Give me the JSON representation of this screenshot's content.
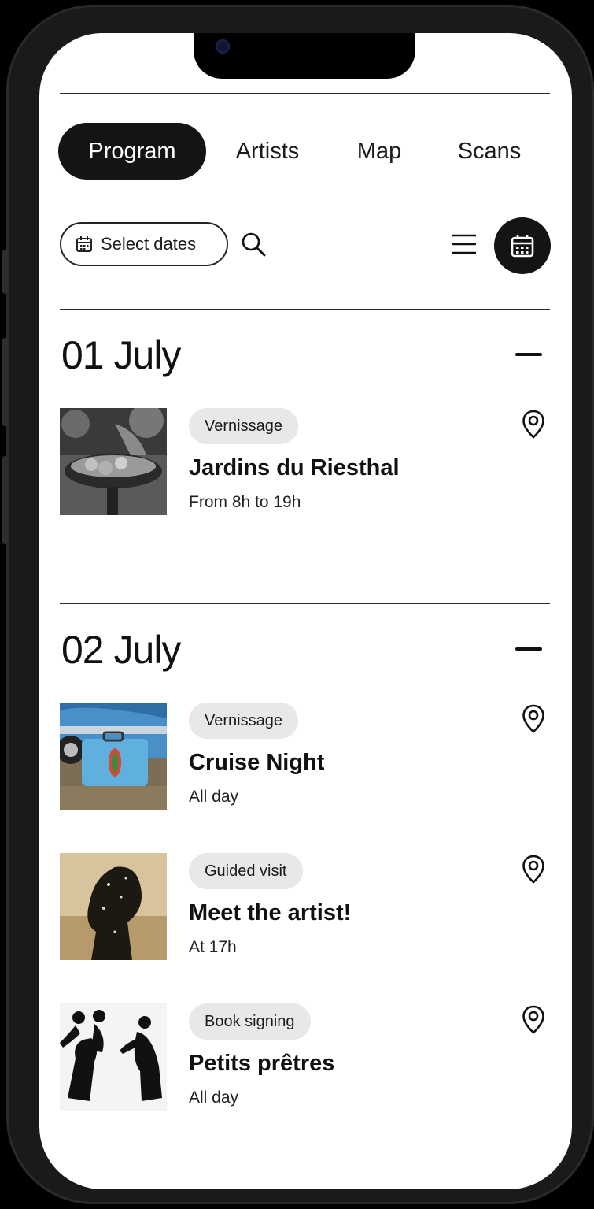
{
  "tabs": [
    {
      "label": "Program",
      "active": true
    },
    {
      "label": "Artists",
      "active": false
    },
    {
      "label": "Map",
      "active": false
    },
    {
      "label": "Scans",
      "active": false
    }
  ],
  "toolbar": {
    "date_filter_label": "Select dates",
    "icons": [
      "calendar-icon",
      "search-icon",
      "list-view-icon",
      "calendar-view-icon"
    ]
  },
  "days": [
    {
      "title": "01 July",
      "events": [
        {
          "tag": "Vernissage",
          "title": "Jardins du Riesthal",
          "time": "From 8h to 19h",
          "thumbnail": "garden-photo"
        }
      ]
    },
    {
      "title": "02 July",
      "events": [
        {
          "tag": "Vernissage",
          "title": "Cruise Night",
          "time": "All day",
          "thumbnail": "blue-car-suitcase-photo"
        },
        {
          "tag": "Guided visit",
          "title": "Meet the artist!",
          "time": "At 17h",
          "thumbnail": "silhouette-photo"
        },
        {
          "tag": "Book signing",
          "title": "Petits prêtres",
          "time": "All day",
          "thumbnail": "priests-running-photo"
        }
      ]
    }
  ],
  "colors": {
    "accent": "#141414",
    "background": "#ffffff",
    "tag_background": "#e8e8e8"
  }
}
